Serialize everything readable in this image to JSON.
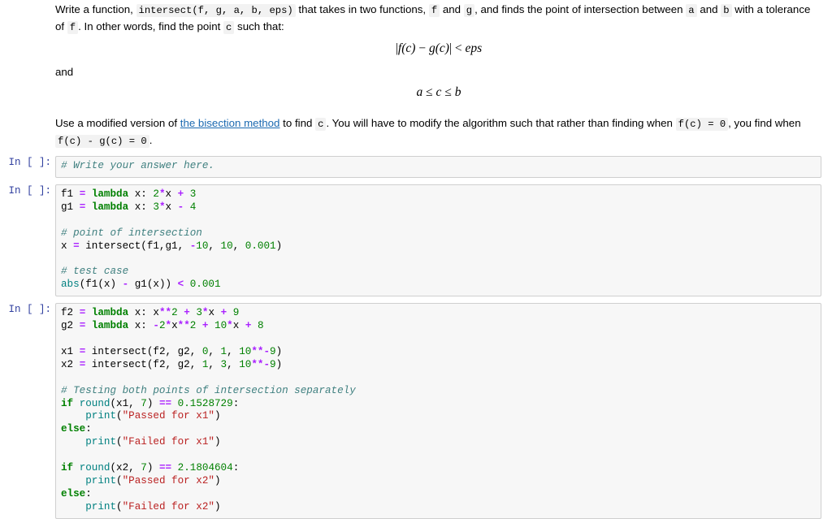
{
  "notebook": {
    "markdown_cell": {
      "paragraph1_parts": [
        {
          "type": "text",
          "text": "Write a function, "
        },
        {
          "type": "code",
          "text": "intersect(f, g, a, b, eps)"
        },
        {
          "type": "text",
          "text": " that takes in two functions, "
        },
        {
          "type": "code",
          "text": "f"
        },
        {
          "type": "text",
          "text": " and "
        },
        {
          "type": "code",
          "text": "g"
        },
        {
          "type": "text",
          "text": ", and finds the point of intersection between "
        },
        {
          "type": "code",
          "text": "a"
        },
        {
          "type": "text",
          "text": " and "
        },
        {
          "type": "code",
          "text": "b"
        },
        {
          "type": "text",
          "text": " with a tolerance of "
        },
        {
          "type": "code",
          "text": "f"
        },
        {
          "type": "text",
          "text": ". In other words, find the point "
        },
        {
          "type": "code",
          "text": "c"
        },
        {
          "type": "text",
          "text": " such that:"
        }
      ],
      "segments": {
        "p1_s1": "Write a function,",
        "p1_code1": "intersect(f, g, a, b, eps)",
        "p1_s2": "that takes in two functions,",
        "p1_code2": "f",
        "p1_s3": "and",
        "p1_code3": "g",
        "p1_s4": ", and finds the point of intersection between",
        "p1_code4": "a",
        "p1_s5": "and",
        "p1_code5": "b",
        "p1_s6": "with a tolerance of",
        "p1_code6": "f",
        "p1_s7": ". In other words, find the point",
        "p1_code7": "c",
        "p1_s8": "such that:",
        "and_word": "and",
        "p2_s1": "Use a modified version of",
        "p2_link": "the bisection method",
        "p2_s2": "to find",
        "p2_code1": "c",
        "p2_s3": ". You will have to modify the algorithm such that rather than finding when",
        "p2_code2": "f(c) = 0",
        "p2_s4": ", you find when",
        "p2_code3": "f(c) - g(c) = 0",
        "p2_s5": "."
      },
      "equation1": "|f(c) − g(c)| < eps",
      "equation1_parts": {
        "bar_open": "|",
        "f": "f",
        "paren_c1": "(c)",
        "minus": " − ",
        "g": "g",
        "paren_c2": "(c)",
        "bar_close": "|",
        "lt": " < ",
        "eps": "eps"
      },
      "equation2": "a ≤ c ≤ b",
      "equation2_parts": {
        "a": "a",
        "le1": " ≤ ",
        "c": "c",
        "le2": " ≤ ",
        "b": "b"
      },
      "link_text": "the bisection method",
      "link_color": "#1c6ab1"
    },
    "code_cells": [
      {
        "prompt": "In [ ]:",
        "lines": [
          [
            {
              "c": "t-c",
              "t": "# Write your answer here."
            }
          ]
        ]
      },
      {
        "prompt": "In [ ]:",
        "lines": [
          [
            {
              "c": "t-p",
              "t": "f1 "
            },
            {
              "c": "t-o",
              "t": "="
            },
            {
              "c": "t-p",
              "t": " "
            },
            {
              "c": "t-k",
              "t": "lambda"
            },
            {
              "c": "t-p",
              "t": " x: "
            },
            {
              "c": "t-n",
              "t": "2"
            },
            {
              "c": "t-o",
              "t": "*"
            },
            {
              "c": "t-p",
              "t": "x "
            },
            {
              "c": "t-o",
              "t": "+"
            },
            {
              "c": "t-p",
              "t": " "
            },
            {
              "c": "t-n",
              "t": "3"
            }
          ],
          [
            {
              "c": "t-p",
              "t": "g1 "
            },
            {
              "c": "t-o",
              "t": "="
            },
            {
              "c": "t-p",
              "t": " "
            },
            {
              "c": "t-k",
              "t": "lambda"
            },
            {
              "c": "t-p",
              "t": " x: "
            },
            {
              "c": "t-n",
              "t": "3"
            },
            {
              "c": "t-o",
              "t": "*"
            },
            {
              "c": "t-p",
              "t": "x "
            },
            {
              "c": "t-o",
              "t": "-"
            },
            {
              "c": "t-p",
              "t": " "
            },
            {
              "c": "t-n",
              "t": "4"
            }
          ],
          [],
          [
            {
              "c": "t-c",
              "t": "# point of intersection"
            }
          ],
          [
            {
              "c": "t-p",
              "t": "x "
            },
            {
              "c": "t-o",
              "t": "="
            },
            {
              "c": "t-p",
              "t": " intersect(f1,g1, "
            },
            {
              "c": "t-o",
              "t": "-"
            },
            {
              "c": "t-n",
              "t": "10"
            },
            {
              "c": "t-p",
              "t": ", "
            },
            {
              "c": "t-n",
              "t": "10"
            },
            {
              "c": "t-p",
              "t": ", "
            },
            {
              "c": "t-n",
              "t": "0.001"
            },
            {
              "c": "t-p",
              "t": ")"
            }
          ],
          [],
          [
            {
              "c": "t-c",
              "t": "# test case"
            }
          ],
          [
            {
              "c": "t-nb",
              "t": "abs"
            },
            {
              "c": "t-p",
              "t": "(f1(x) "
            },
            {
              "c": "t-o",
              "t": "-"
            },
            {
              "c": "t-p",
              "t": " g1(x)) "
            },
            {
              "c": "t-o",
              "t": "<"
            },
            {
              "c": "t-p",
              "t": " "
            },
            {
              "c": "t-n",
              "t": "0.001"
            }
          ]
        ]
      },
      {
        "prompt": "In [ ]:",
        "lines": [
          [
            {
              "c": "t-p",
              "t": "f2 "
            },
            {
              "c": "t-o",
              "t": "="
            },
            {
              "c": "t-p",
              "t": " "
            },
            {
              "c": "t-k",
              "t": "lambda"
            },
            {
              "c": "t-p",
              "t": " x: x"
            },
            {
              "c": "t-o",
              "t": "**"
            },
            {
              "c": "t-n",
              "t": "2"
            },
            {
              "c": "t-p",
              "t": " "
            },
            {
              "c": "t-o",
              "t": "+"
            },
            {
              "c": "t-p",
              "t": " "
            },
            {
              "c": "t-n",
              "t": "3"
            },
            {
              "c": "t-o",
              "t": "*"
            },
            {
              "c": "t-p",
              "t": "x "
            },
            {
              "c": "t-o",
              "t": "+"
            },
            {
              "c": "t-p",
              "t": " "
            },
            {
              "c": "t-n",
              "t": "9"
            }
          ],
          [
            {
              "c": "t-p",
              "t": "g2 "
            },
            {
              "c": "t-o",
              "t": "="
            },
            {
              "c": "t-p",
              "t": " "
            },
            {
              "c": "t-k",
              "t": "lambda"
            },
            {
              "c": "t-p",
              "t": " x: "
            },
            {
              "c": "t-o",
              "t": "-"
            },
            {
              "c": "t-n",
              "t": "2"
            },
            {
              "c": "t-o",
              "t": "*"
            },
            {
              "c": "t-p",
              "t": "x"
            },
            {
              "c": "t-o",
              "t": "**"
            },
            {
              "c": "t-n",
              "t": "2"
            },
            {
              "c": "t-p",
              "t": " "
            },
            {
              "c": "t-o",
              "t": "+"
            },
            {
              "c": "t-p",
              "t": " "
            },
            {
              "c": "t-n",
              "t": "10"
            },
            {
              "c": "t-o",
              "t": "*"
            },
            {
              "c": "t-p",
              "t": "x "
            },
            {
              "c": "t-o",
              "t": "+"
            },
            {
              "c": "t-p",
              "t": " "
            },
            {
              "c": "t-n",
              "t": "8"
            }
          ],
          [],
          [
            {
              "c": "t-p",
              "t": "x1 "
            },
            {
              "c": "t-o",
              "t": "="
            },
            {
              "c": "t-p",
              "t": " intersect(f2, g2, "
            },
            {
              "c": "t-n",
              "t": "0"
            },
            {
              "c": "t-p",
              "t": ", "
            },
            {
              "c": "t-n",
              "t": "1"
            },
            {
              "c": "t-p",
              "t": ", "
            },
            {
              "c": "t-n",
              "t": "10"
            },
            {
              "c": "t-o",
              "t": "**-"
            },
            {
              "c": "t-n",
              "t": "9"
            },
            {
              "c": "t-p",
              "t": ")"
            }
          ],
          [
            {
              "c": "t-p",
              "t": "x2 "
            },
            {
              "c": "t-o",
              "t": "="
            },
            {
              "c": "t-p",
              "t": " intersect(f2, g2, "
            },
            {
              "c": "t-n",
              "t": "1"
            },
            {
              "c": "t-p",
              "t": ", "
            },
            {
              "c": "t-n",
              "t": "3"
            },
            {
              "c": "t-p",
              "t": ", "
            },
            {
              "c": "t-n",
              "t": "10"
            },
            {
              "c": "t-o",
              "t": "**-"
            },
            {
              "c": "t-n",
              "t": "9"
            },
            {
              "c": "t-p",
              "t": ")"
            }
          ],
          [],
          [
            {
              "c": "t-c",
              "t": "# Testing both points of intersection separately"
            }
          ],
          [
            {
              "c": "t-k",
              "t": "if"
            },
            {
              "c": "t-p",
              "t": " "
            },
            {
              "c": "t-nb",
              "t": "round"
            },
            {
              "c": "t-p",
              "t": "(x1, "
            },
            {
              "c": "t-n",
              "t": "7"
            },
            {
              "c": "t-p",
              "t": ") "
            },
            {
              "c": "t-o",
              "t": "=="
            },
            {
              "c": "t-p",
              "t": " "
            },
            {
              "c": "t-n",
              "t": "0.1528729"
            },
            {
              "c": "t-p",
              "t": ":"
            }
          ],
          [
            {
              "c": "t-p",
              "t": "    "
            },
            {
              "c": "t-nb",
              "t": "print"
            },
            {
              "c": "t-p",
              "t": "("
            },
            {
              "c": "t-s",
              "t": "\"Passed for x1\""
            },
            {
              "c": "t-p",
              "t": ")"
            }
          ],
          [
            {
              "c": "t-k",
              "t": "else"
            },
            {
              "c": "t-p",
              "t": ":"
            }
          ],
          [
            {
              "c": "t-p",
              "t": "    "
            },
            {
              "c": "t-nb",
              "t": "print"
            },
            {
              "c": "t-p",
              "t": "("
            },
            {
              "c": "t-s",
              "t": "\"Failed for x1\""
            },
            {
              "c": "t-p",
              "t": ")"
            }
          ],
          [],
          [
            {
              "c": "t-k",
              "t": "if"
            },
            {
              "c": "t-p",
              "t": " "
            },
            {
              "c": "t-nb",
              "t": "round"
            },
            {
              "c": "t-p",
              "t": "(x2, "
            },
            {
              "c": "t-n",
              "t": "7"
            },
            {
              "c": "t-p",
              "t": ") "
            },
            {
              "c": "t-o",
              "t": "=="
            },
            {
              "c": "t-p",
              "t": " "
            },
            {
              "c": "t-n",
              "t": "2.1804604"
            },
            {
              "c": "t-p",
              "t": ":"
            }
          ],
          [
            {
              "c": "t-p",
              "t": "    "
            },
            {
              "c": "t-nb",
              "t": "print"
            },
            {
              "c": "t-p",
              "t": "("
            },
            {
              "c": "t-s",
              "t": "\"Passed for x2\""
            },
            {
              "c": "t-p",
              "t": ")"
            }
          ],
          [
            {
              "c": "t-k",
              "t": "else"
            },
            {
              "c": "t-p",
              "t": ":"
            }
          ],
          [
            {
              "c": "t-p",
              "t": "    "
            },
            {
              "c": "t-nb",
              "t": "print"
            },
            {
              "c": "t-p",
              "t": "("
            },
            {
              "c": "t-s",
              "t": "\"Failed for x2\""
            },
            {
              "c": "t-p",
              "t": ")"
            }
          ]
        ]
      }
    ],
    "theme": {
      "cell_background": "#f7f7f7",
      "cell_border": "#cfcfcf",
      "prompt_color": "#303F9F",
      "keyword_color": "#008000",
      "builtin_color": "#008080",
      "comment_color": "#408080",
      "string_color": "#BA2121",
      "operator_color": "#AA22FF",
      "inline_code_background": "#f2f2f2"
    }
  }
}
